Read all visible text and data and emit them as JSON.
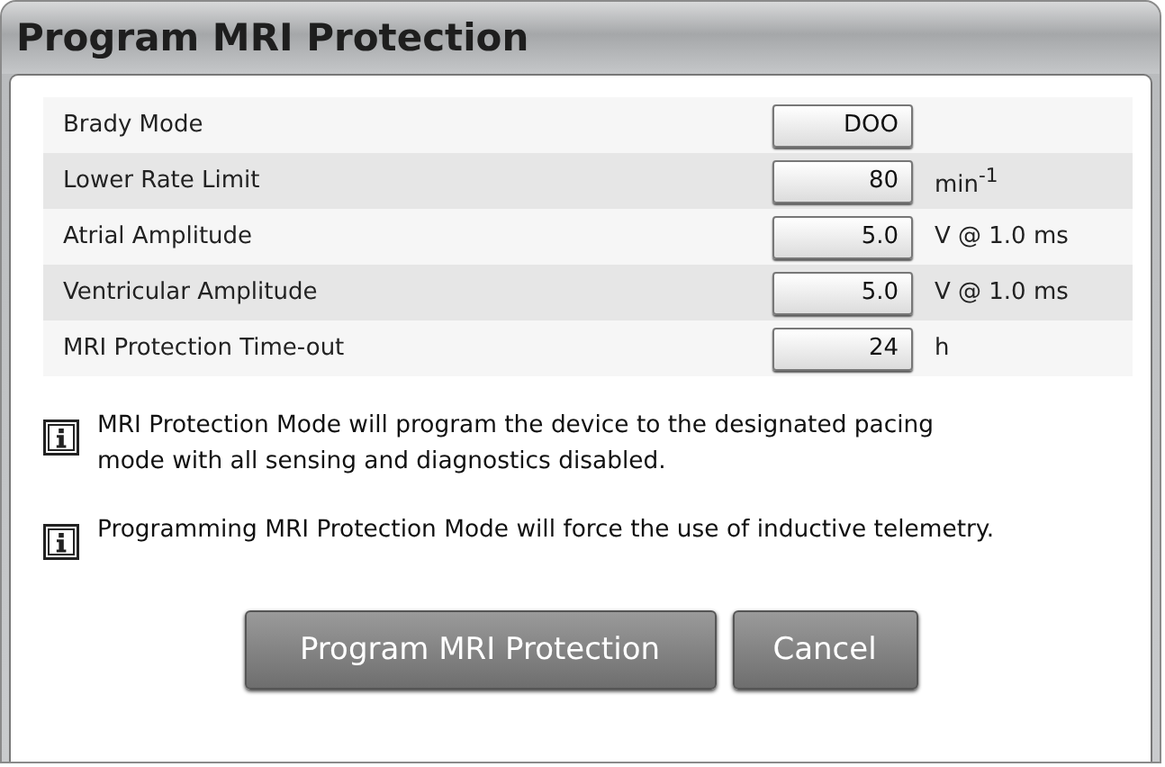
{
  "window": {
    "title": "Program MRI Protection"
  },
  "parameters": [
    {
      "label": "Brady Mode",
      "value": "DOO"
    },
    {
      "label": "Lower Rate Limit",
      "value": "80",
      "unit": "min$^{-1}$"
    },
    {
      "label": "Atrial Amplitude",
      "value": "5.0",
      "unit": "V @ 1.0 ms"
    },
    {
      "label": "Ventricular Amplitude",
      "value": "5.0",
      "unit": "V @ 1.0 ms"
    },
    {
      "label": "MRI Protection Time-out",
      "value": "24",
      "unit": "h"
    }
  ],
  "notes": [
    "MRI Protection Mode will program the device to the designated pacing mode with all sensing and diagnostics disabled.",
    "Programming MRI Protection Mode will force the use of inductive telemetry."
  ],
  "buttons": [
    "Program MRI Protection",
    "Cancel"
  ]
}
